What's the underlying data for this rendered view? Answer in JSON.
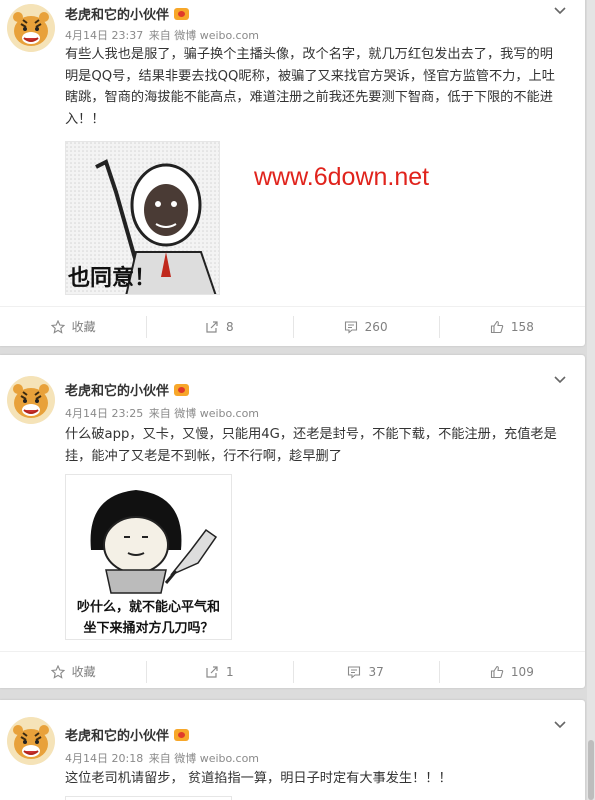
{
  "posts": [
    {
      "user": "老虎和它的小伙伴",
      "time": "4月14日 23:37",
      "source": "来自 微博 weibo.com",
      "text": "有些人我也是服了，骗子换个主播头像，改个名字，就几万红包发出去了，我写的明明是QQ号，结果非要去找QQ昵称，被骗了又来找官方哭诉，怪官方监管不力，上吐瞎跳，智商的海拔能不能高点，难道注册之前我还先要测下智商，低于下限的不能进入！！",
      "image_caption": "也同意！",
      "actions": {
        "favorite": "收藏",
        "forward": "8",
        "comment": "260",
        "like": "158"
      }
    },
    {
      "user": "老虎和它的小伙伴",
      "time": "4月14日 23:25",
      "source": "来自 微博 weibo.com",
      "text": "什么破app，又卡，又慢，只能用4G，还老是封号，不能下载，不能注册，充值老是挂，能冲了又老是不到帐，行不行啊，趁早删了",
      "image_caption_line1": "吵什么，就不能心平气和",
      "image_caption_line2": "坐下来捅对方几刀吗？",
      "actions": {
        "favorite": "收藏",
        "forward": "1",
        "comment": "37",
        "like": "109"
      }
    },
    {
      "user": "老虎和它的小伙伴",
      "time": "4月14日 20:18",
      "source": "来自 微博 weibo.com",
      "text": "这位老司机请留步， 贫道掐指一算，明日子时定有大事发生！！！"
    }
  ],
  "watermark": "www.6down.net",
  "icons": [
    "avatar-tiger",
    "vip-crown-icon",
    "chevron-down-icon",
    "star-icon",
    "forward-icon",
    "comment-icon",
    "thumbs-up-icon"
  ],
  "colors": {
    "background": "#dcdcdc",
    "card": "#ffffff",
    "meta": "#8a8a8a",
    "watermark": "#e0231c",
    "vip": "#f7a72a"
  }
}
